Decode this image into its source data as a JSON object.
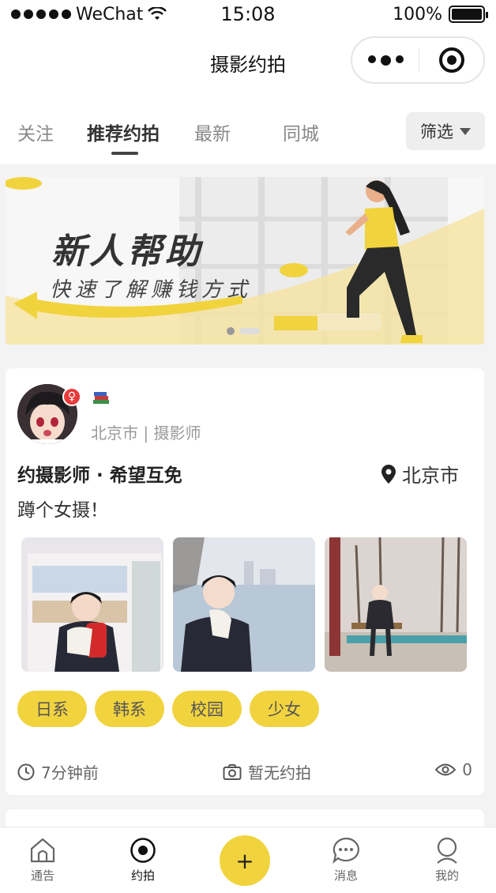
{
  "status_bar": {
    "carrier": "WeChat",
    "time": "15:08",
    "battery": "100%"
  },
  "nav": {
    "title": "摄影约拍"
  },
  "tabs": [
    {
      "label": "关注"
    },
    {
      "label": "推荐约拍",
      "active": true
    },
    {
      "label": "最新"
    },
    {
      "label": "同城"
    }
  ],
  "filter": {
    "label": "筛选"
  },
  "banner": {
    "title": "新人帮助",
    "subtitle": "快速了解赚钱方式"
  },
  "post": {
    "user_meta": "北京市 | 摄影师",
    "title": "约摄影师 · 希望互免",
    "location": "北京市",
    "body": "蹲个女摄！",
    "tags": [
      "日系",
      "韩系",
      "校园",
      "少女"
    ],
    "time": "7分钟前",
    "shoot_status": "暂无约拍",
    "views": "0"
  },
  "tabbar": [
    {
      "label": "通告"
    },
    {
      "label": "约拍",
      "active": true
    },
    {
      "label": "消息"
    },
    {
      "label": "我的"
    }
  ],
  "fab": {
    "label": "+"
  },
  "colors": {
    "accent": "#f1d33e",
    "female_badge": "#e83c3c"
  }
}
